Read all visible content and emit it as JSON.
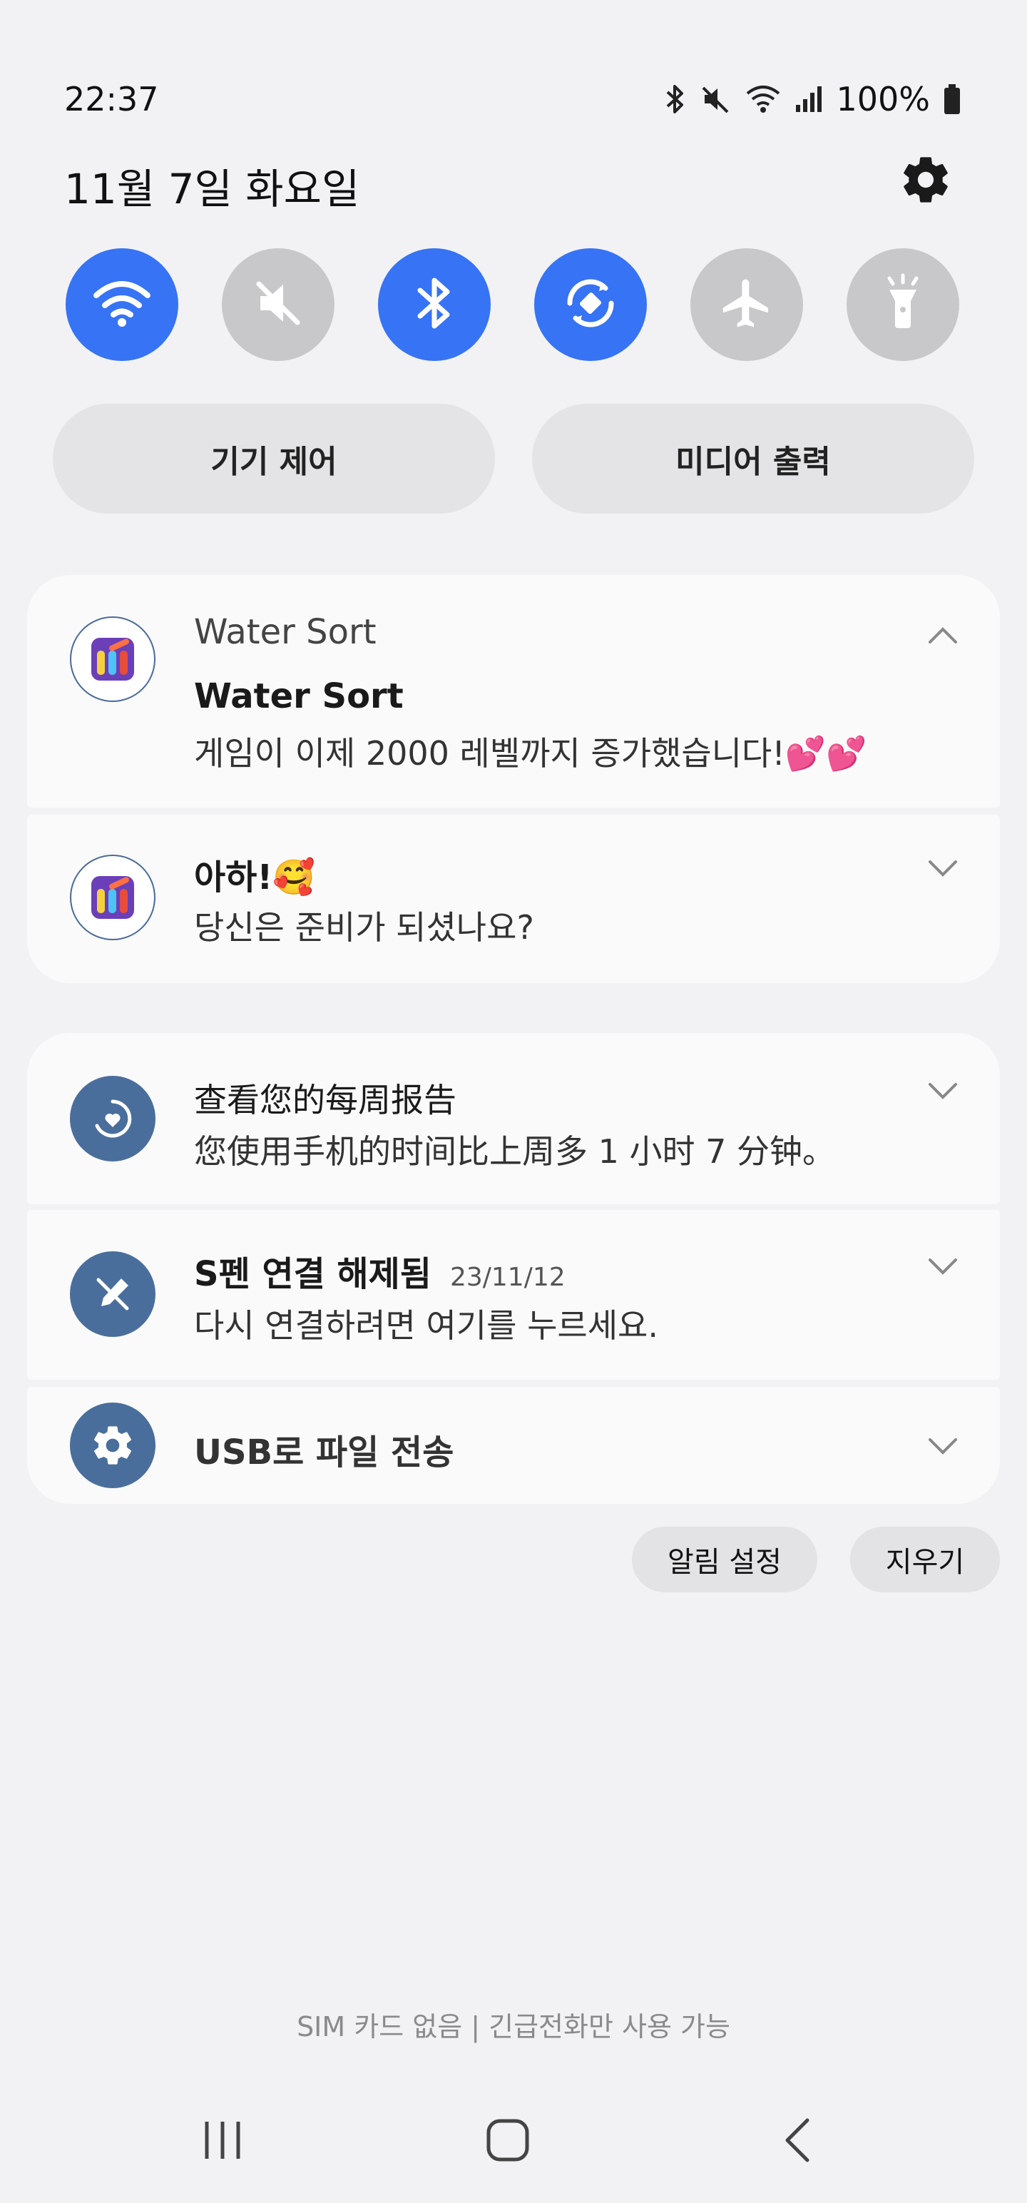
{
  "status_bar": {
    "time": "22:37",
    "battery": "100%",
    "icons": [
      "bluetooth-icon",
      "mute-icon",
      "wifi-icon",
      "signal-icon",
      "battery-icon"
    ]
  },
  "header": {
    "date": "11월 7일 화요일",
    "settings_icon": "gear-icon"
  },
  "quick_settings": [
    {
      "name": "wifi",
      "icon": "wifi-icon",
      "state": "on"
    },
    {
      "name": "sound",
      "icon": "mute-icon",
      "state": "off"
    },
    {
      "name": "bluetooth",
      "icon": "bluetooth-icon",
      "state": "on"
    },
    {
      "name": "auto-rotate",
      "icon": "rotate-icon",
      "state": "on"
    },
    {
      "name": "airplane",
      "icon": "airplane-icon",
      "state": "off"
    },
    {
      "name": "flashlight",
      "icon": "flashlight-icon",
      "state": "off"
    }
  ],
  "panels": {
    "device_control": "기기 제어",
    "media_output": "미디어 출력"
  },
  "notifications": {
    "water_sort": {
      "app_name": "Water Sort",
      "title": "Water Sort",
      "body": "게임이 이제 2000 레벨까지 증가했습니다!💕💕"
    },
    "aha": {
      "title": "아하!🥰",
      "body": "당신은 준비가 되셨나요?"
    },
    "weekly_report": {
      "title": "查看您的每周报告",
      "body": "您使用手机的时间比上周多 1 小时 7 分钟。"
    },
    "spen": {
      "title": "S펜 연결 해제됨",
      "time": "23/11/12",
      "body": "다시 연결하려면 여기를 누르세요."
    },
    "usb": {
      "title": "USB로 파일 전송"
    }
  },
  "actions": {
    "notification_settings": "알림 설정",
    "clear": "지우기"
  },
  "footer": {
    "sim_status": "SIM 카드 없음 | 긴급전화만 사용 가능"
  },
  "colors": {
    "accent": "#3673f5",
    "inactive_toggle": "#c8c8ca",
    "system_icon": "#4a6e9c",
    "background": "#f2f2f4"
  }
}
